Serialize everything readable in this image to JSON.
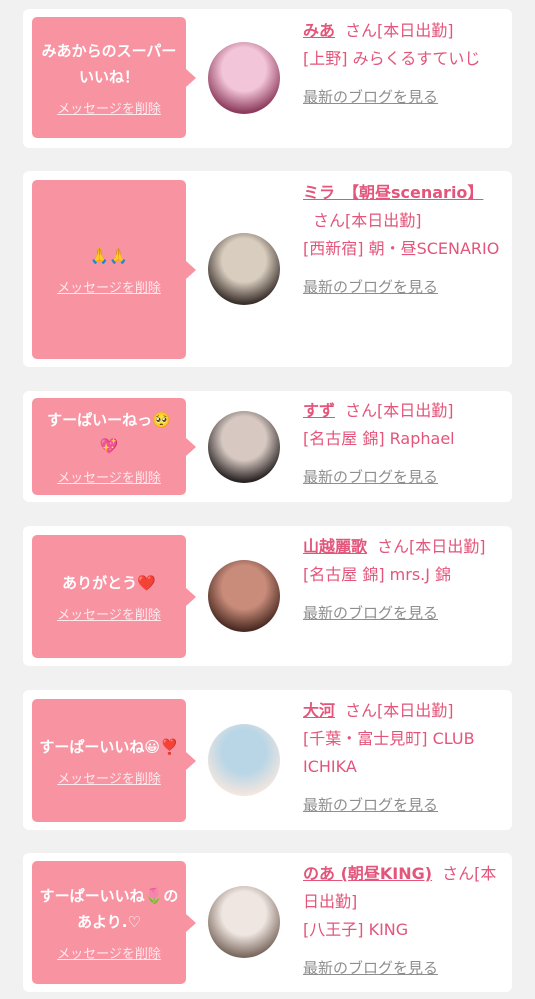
{
  "delete_label": "メッセージを削除",
  "blog_label": "最新のブログを見る",
  "suffix": "さん[本日出勤]",
  "colors": {
    "bubble": "#f893a2",
    "accent": "#e3557a",
    "blog_link": "#8e8e8e",
    "card": "#ffffff",
    "page_bg": "#f1f1f1"
  },
  "items": [
    {
      "message": "みあからのスーパーいいね！",
      "name": "みあ",
      "shop": "[上野] みらくるすていじ",
      "avatar_colors": [
        "#f3c5d8",
        "#8c3b5c"
      ]
    },
    {
      "message": "🙏🙏",
      "name": "ミラ　【朝昼scenario】",
      "shop": "[西新宿] 朝・昼SCENARIO",
      "avatar_colors": [
        "#d9cdbf",
        "#3a302b"
      ]
    },
    {
      "message": "すーぱいーねっ🥺💖",
      "name": "すず",
      "shop": "[名古屋 錦] Raphael",
      "avatar_colors": [
        "#d7c9c2",
        "#2a2424"
      ]
    },
    {
      "message": "ありがとう❤️",
      "name": "山越麗歌",
      "shop": "[名古屋 錦] mrs.J 錦",
      "avatar_colors": [
        "#c98c7a",
        "#4a2a22"
      ]
    },
    {
      "message": "すーぱーいいね😀❣️",
      "name": "大河",
      "shop": "[千葉・富士見町] CLUB ICHIKA",
      "avatar_colors": [
        "#b9d6e6",
        "#f2e6df"
      ]
    },
    {
      "message": "すーぱーいいね🌷のあより.♡",
      "name": "のあ (朝昼KING)",
      "shop": "[八王子] KING",
      "avatar_colors": [
        "#efe6e1",
        "#7c6a60"
      ]
    }
  ]
}
